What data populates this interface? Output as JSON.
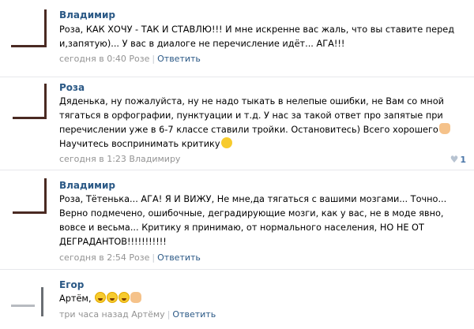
{
  "comments": [
    {
      "author": "Владимир",
      "lines": [
        "Роза, КАК ХОЧУ - ТАК И СТАВЛЮ!!! И мне искренне вас жаль, что вы ставите перед",
        "и,запятую)... У вас в диалоге не перечисление идёт... АГА!!!"
      ],
      "timestamp": "сегодня в 0:40",
      "reply_to": "Розе",
      "reply_label": "Ответить",
      "emojis": []
    },
    {
      "author": "Роза",
      "lines": [
        "Дяденька, ну пожалуйста, ну не надо тыкать в нелепые ошибки, не Вам со мной",
        "тягаться в орфографии, пунктуации и т.д. У нас за такой ответ про запятые при",
        "перечислении уже в 6-7 классе ставили тройки. Остановитесь) Всего хорошего",
        "Научитесь воспринимать критику"
      ],
      "timestamp": "сегодня в 1:23",
      "reply_to": "Владимиру",
      "reply_label": "",
      "likes": "1",
      "emojis": [
        "raised-hand-emoji",
        "wink-emoji"
      ]
    },
    {
      "author": "Владимир",
      "lines": [
        "Роза, Тётенька... АГА! Я И ВИЖУ, Не мне,да тягаться с вашими мозгами... Точно...",
        "Верно подмечено, ошибочные, деградирующие мозги, как у вас, не в моде явно,",
        "вовсе и весьма... Критику я принимаю, от нормального населения, НО НЕ ОТ",
        "ДЕГРАДАНТОВ!!!!!!!!!!!"
      ],
      "timestamp": "сегодня в 2:54",
      "reply_to": "Розе",
      "reply_label": "Ответить",
      "emojis": []
    },
    {
      "author": "Егор",
      "lines": [
        "Артём,"
      ],
      "timestamp": "три часа назад",
      "reply_to": "Артёму",
      "reply_label": "Ответить",
      "emojis": [
        "laughing-tears-emoji",
        "laughing-tears-emoji",
        "laughing-tears-emoji",
        "ok-hand-emoji"
      ]
    }
  ],
  "colors": {
    "link": "#2a5885",
    "meta": "#939393",
    "divider": "#e7e8ec",
    "like_count": "#4a76a8"
  }
}
